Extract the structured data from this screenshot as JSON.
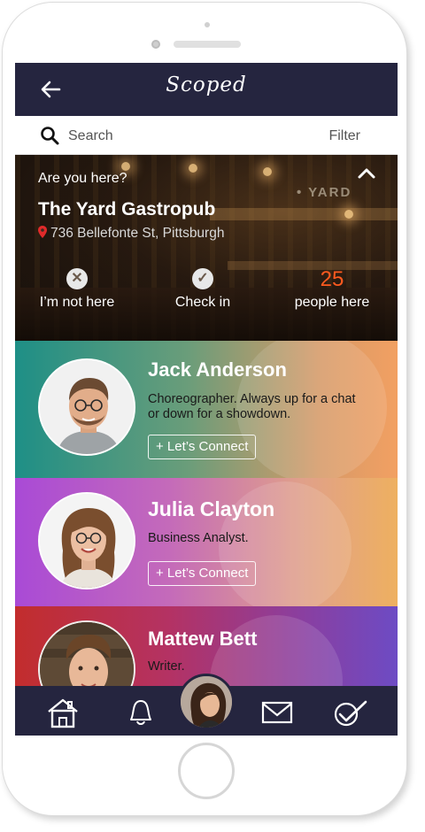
{
  "header": {
    "title": "Scoped"
  },
  "search": {
    "placeholder": "Search",
    "filter_label": "Filter"
  },
  "venue": {
    "prompt": "Are you here?",
    "name": "The Yard Gastropub",
    "address": "736 Bellefonte St, Pittsburgh",
    "sign_text": "• YARD",
    "actions": {
      "not_here_label": "I’m not here",
      "check_in_label": "Check in",
      "people_count": "25",
      "people_label": "people here"
    }
  },
  "people": [
    {
      "name": "Jack Anderson",
      "description": "Choreographer. Always up for a chat or down for a showdown.",
      "connect_label": "+ Let’s Connect"
    },
    {
      "name": "Julia Clayton",
      "description": "Business Analyst.",
      "connect_label": "+ Let’s Connect"
    },
    {
      "name": "Mattew Bett",
      "description": "Writer."
    }
  ],
  "nav": {
    "items": [
      "home-icon",
      "bell-icon",
      "profile-avatar",
      "mail-icon",
      "check-icon"
    ]
  },
  "colors": {
    "header_bg": "#25253f",
    "accent_count": "#ff5a1f"
  }
}
